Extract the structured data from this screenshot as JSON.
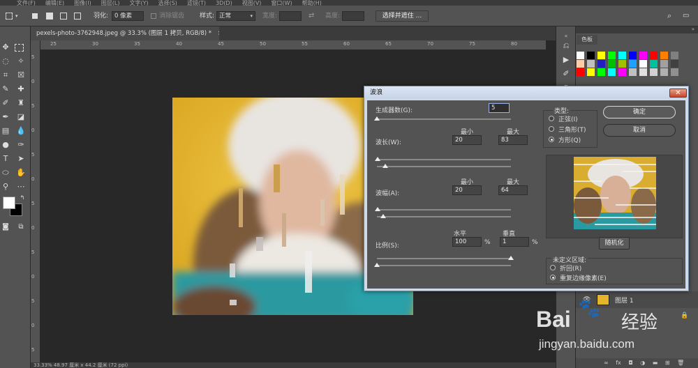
{
  "menu": [
    "文件(F)",
    "编辑(E)",
    "图像(I)",
    "图层(L)",
    "文字(Y)",
    "选择(S)",
    "滤镜(T)",
    "3D(D)",
    "视图(V)",
    "窗口(W)",
    "帮助(H)"
  ],
  "options_bar": {
    "feather_label": "羽化:",
    "feather_value": "0 像素",
    "antialias_label": "消除锯齿",
    "style_label": "样式:",
    "style_value": "正常",
    "width_label": "宽度:",
    "height_label": "高度:",
    "select_mask_button": "选择并遮住 ..."
  },
  "document_tab": {
    "title": "pexels-photo-3762948.jpeg @ 33.3% (图层 1 拷贝, RGB/8) *",
    "close": "×"
  },
  "ruler_top": [
    "25",
    "30",
    "35",
    "40",
    "45",
    "50",
    "55",
    "60",
    "65",
    "70",
    "75",
    "80"
  ],
  "ruler_left": [
    "5",
    "0",
    "5",
    "0",
    "5",
    "0",
    "5",
    "0",
    "5",
    "0",
    "5",
    "0",
    "5"
  ],
  "status_bar": "33.33%    48.97 厘米 x 44.2 厘米 (72 ppi)",
  "panels": {
    "swatches_tab": "色板",
    "layer_name": "图层 1",
    "swatch_colors": [
      "#ffffff",
      "#000000",
      "#ffff00",
      "#00ff00",
      "#00ffff",
      "#0000ff",
      "#ff00ff",
      "#ff0000",
      "#ff8000",
      "#808080",
      "#ffccaa",
      "#c0c0c0",
      "#2020c0",
      "#00c000",
      "#a0c000",
      "#20a0ff",
      "#ffffff",
      "#00c0a0",
      "#a0a0a0",
      "#404040",
      "#ff0000",
      "#ffff00",
      "#00ff00",
      "#00ffff",
      "#ff00ff",
      "#c0c0c0",
      "#e0e0e0",
      "#d0d0d0",
      "#b0b0b0",
      "#909090"
    ]
  },
  "dialog": {
    "title": "波浪",
    "close": "✕",
    "generators_label": "生成器数(G):",
    "generators_value": "5",
    "wavelength_label": "波长(W):",
    "wavelength_min": "20",
    "wavelength_max": "83",
    "amplitude_label": "波幅(A):",
    "amplitude_min": "20",
    "amplitude_max": "64",
    "min_label": "最小",
    "max_label": "最大",
    "scale_label": "比例(S):",
    "horizontal_label": "水平",
    "vertical_label": "垂直",
    "horizontal_value": "100",
    "vertical_value": "1",
    "percent": "%",
    "type_label": "类型:",
    "type_sine": "正弦(I)",
    "type_triangle": "三角形(T)",
    "type_square": "方形(Q)",
    "ok_button": "确定",
    "cancel_button": "取消",
    "randomize_button": "随机化",
    "undefined_area_label": "未定义区域:",
    "wrap_around": "折回(R)",
    "repeat_edge": "重复边缘像素(E)"
  },
  "watermark": {
    "brand": "Bai",
    "brand_cn": "经验",
    "url": "jingyan.baidu.com"
  }
}
